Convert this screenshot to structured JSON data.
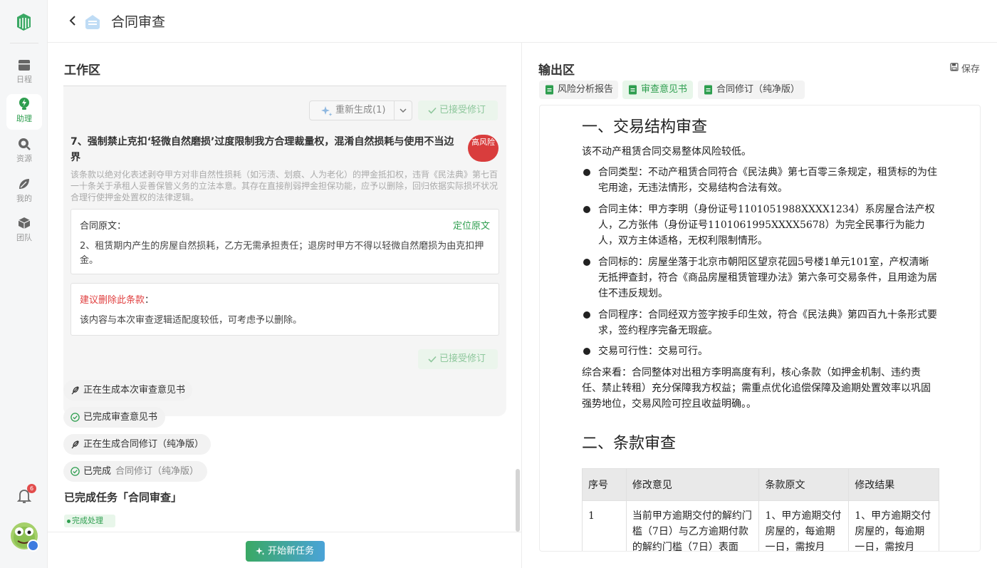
{
  "nav": {
    "items": [
      {
        "label": "日程",
        "icon": "calendar-icon"
      },
      {
        "label": "助理",
        "icon": "bulb-icon"
      },
      {
        "label": "资源",
        "icon": "search-icon"
      },
      {
        "label": "我的",
        "icon": "leaf-icon"
      },
      {
        "label": "团队",
        "icon": "cube-icon"
      }
    ],
    "active": "助理",
    "notification_count": "6"
  },
  "header": {
    "title": "合同审查"
  },
  "workspace": {
    "title": "工作区",
    "regen_label": "重新生成(1)",
    "accepted_label": "已接受修订",
    "item": {
      "title": "7、强制禁止克扣‘轻微自然磨损’过度限制我方合理裁量权，混淆自然损耗与使用不当边界",
      "risk": "高风险",
      "desc": "该条款以绝对化表述剥夺甲方对非自然性损耗（如污渍、划痕、人为老化）的押金抵扣权，违背《民法典》第七百一十条关于承租人妥善保管义务的立法本意。其存在直接削弱押金担保功能，应予以删除，回归依据实际损坏状况合理行使押金处置权的法律逻辑。",
      "original_label": "合同原文：",
      "locate_label": "定位原文",
      "original_text": "2、租赁期内产生的房屋自然损耗，乙方无需承担责任；退房时甲方不得以轻微自然磨损为由克扣押金。",
      "suggest_label": "建议删除此条款",
      "suggest_colon": "：",
      "suggest_text": "该内容与本次审查逻辑适配度较低，可考虑予以删除。"
    },
    "steps": [
      {
        "label": "正在生成本次审查意见书",
        "extra": ""
      },
      {
        "label": "已完成审查意见书",
        "extra": ""
      },
      {
        "label": "正在生成合同修订（纯净版）",
        "extra": ""
      },
      {
        "label": "已完成",
        "extra": "合同修订（纯净版）"
      }
    ],
    "done_title": "已完成任务「合同审查」",
    "done_badge": "完成处理",
    "new_task_label": "开始新任务"
  },
  "output": {
    "title": "输出区",
    "save_label": "保存",
    "tabs": [
      "风险分析报告",
      "审查意见书",
      "合同修订（纯净版）"
    ],
    "active_tab": "审查意见书",
    "doc": {
      "h1": "一、交易结构审查",
      "intro": "该不动产租赁合同交易整体风险较低。",
      "bullets": [
        "合同类型：不动产租赁合同符合《民法典》第七百零三条规定，租赁标的为住宅用途，无违法情形，交易结构合法有效。",
        "合同主体：甲方李明（身份证号1101051988XXXX1234）系房屋合法产权人，乙方张伟（身份证号1101061995XXXX5678）为完全民事行为能力人，双方主体适格，无权利限制情形。",
        "合同标的：房屋坐落于北京市朝阳区望京花园5号楼1单元101室，产权清晰无抵押查封，符合《商品房屋租赁管理办法》第六条可交易条件，且用途为居住不违反规划。",
        "合同程序：合同经双方签字按手印生效，符合《民法典》第四百九十条形式要求，签约程序完备无瑕疵。",
        "交易可行性：交易可行。"
      ],
      "summary": "综合来看：合同整体对出租方李明高度有利，核心条款（如押金机制、违约责任、禁止转租）充分保障我方权益；需重点优化追偿保障及逾期处置效率以巩固强势地位，交易风险可控且收益明确。。",
      "h2": "二、条款审查",
      "table": {
        "headers": [
          "序号",
          "修改意见",
          "条款原文",
          "修改结果"
        ],
        "rows": [
          [
            "1",
            "当前甲方逾期交付的解约门槛（7日）与乙方逾期付款的解约门槛（7日）表面",
            "1、甲方逾期交付房屋的，每逾期一日，需按月",
            "1、甲方逾期交付房屋的，每逾期一日，需按月"
          ]
        ]
      }
    }
  }
}
